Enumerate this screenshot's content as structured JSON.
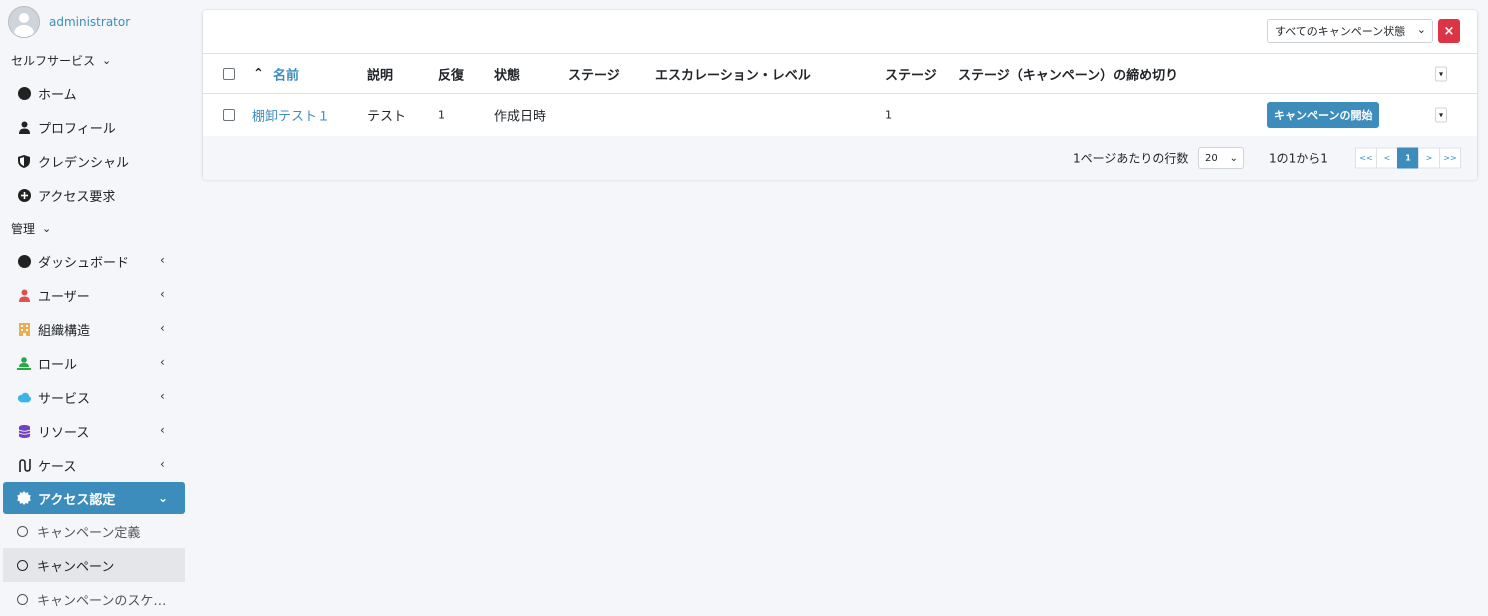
{
  "user": {
    "name": "administrator"
  },
  "sidebar": {
    "self_service": {
      "label": "セルフサービス",
      "items": [
        {
          "label": "ホーム",
          "icon": "dashboard-icon"
        },
        {
          "label": "プロフィール",
          "icon": "user-icon"
        },
        {
          "label": "クレデンシャル",
          "icon": "shield-icon"
        },
        {
          "label": "アクセス要求",
          "icon": "plus-circle-icon"
        }
      ]
    },
    "admin": {
      "label": "管理",
      "items": [
        {
          "label": "ダッシュボード",
          "icon": "dashboard-icon"
        },
        {
          "label": "ユーザー",
          "icon": "user-icon"
        },
        {
          "label": "組織構造",
          "icon": "building-icon"
        },
        {
          "label": "ロール",
          "icon": "role-icon"
        },
        {
          "label": "サービス",
          "icon": "cloud-icon"
        },
        {
          "label": "リソース",
          "icon": "database-icon"
        },
        {
          "label": "ケース",
          "icon": "route-icon"
        },
        {
          "label": "アクセス認定",
          "icon": "certificate-icon"
        }
      ]
    },
    "sub_items": [
      {
        "label": "キャンペーン定義"
      },
      {
        "label": "キャンペーン"
      },
      {
        "label": "キャンペーンのスケ…"
      }
    ]
  },
  "filter": {
    "status_select": "すべてのキャンペーン状態",
    "clear_icon": "×"
  },
  "table": {
    "headers": {
      "name": "名前",
      "description": "説明",
      "iteration": "反復",
      "state": "状態",
      "stage": "ステージ",
      "escalation": "エスカレーション・レベル",
      "stage_number": "ステージ",
      "deadline": "ステージ（キャンペーン）の締め切り"
    },
    "rows": [
      {
        "name": "棚卸テスト１",
        "description": "テスト",
        "iteration": "1",
        "state": "作成日時",
        "stage": "",
        "escalation": "",
        "stage_number": "1",
        "deadline": "",
        "action": "キャンペーンの開始"
      }
    ]
  },
  "pagination": {
    "rows_per_page_label": "1ページあたりの行数",
    "rows_per_page": "20",
    "range_text": "1の1から1",
    "buttons": [
      "<<",
      "<",
      "1",
      ">",
      ">>"
    ]
  },
  "colors": {
    "primary": "#3c8dbc",
    "danger": "#dc3545",
    "sidebar_bg": "#f4f6f9"
  }
}
